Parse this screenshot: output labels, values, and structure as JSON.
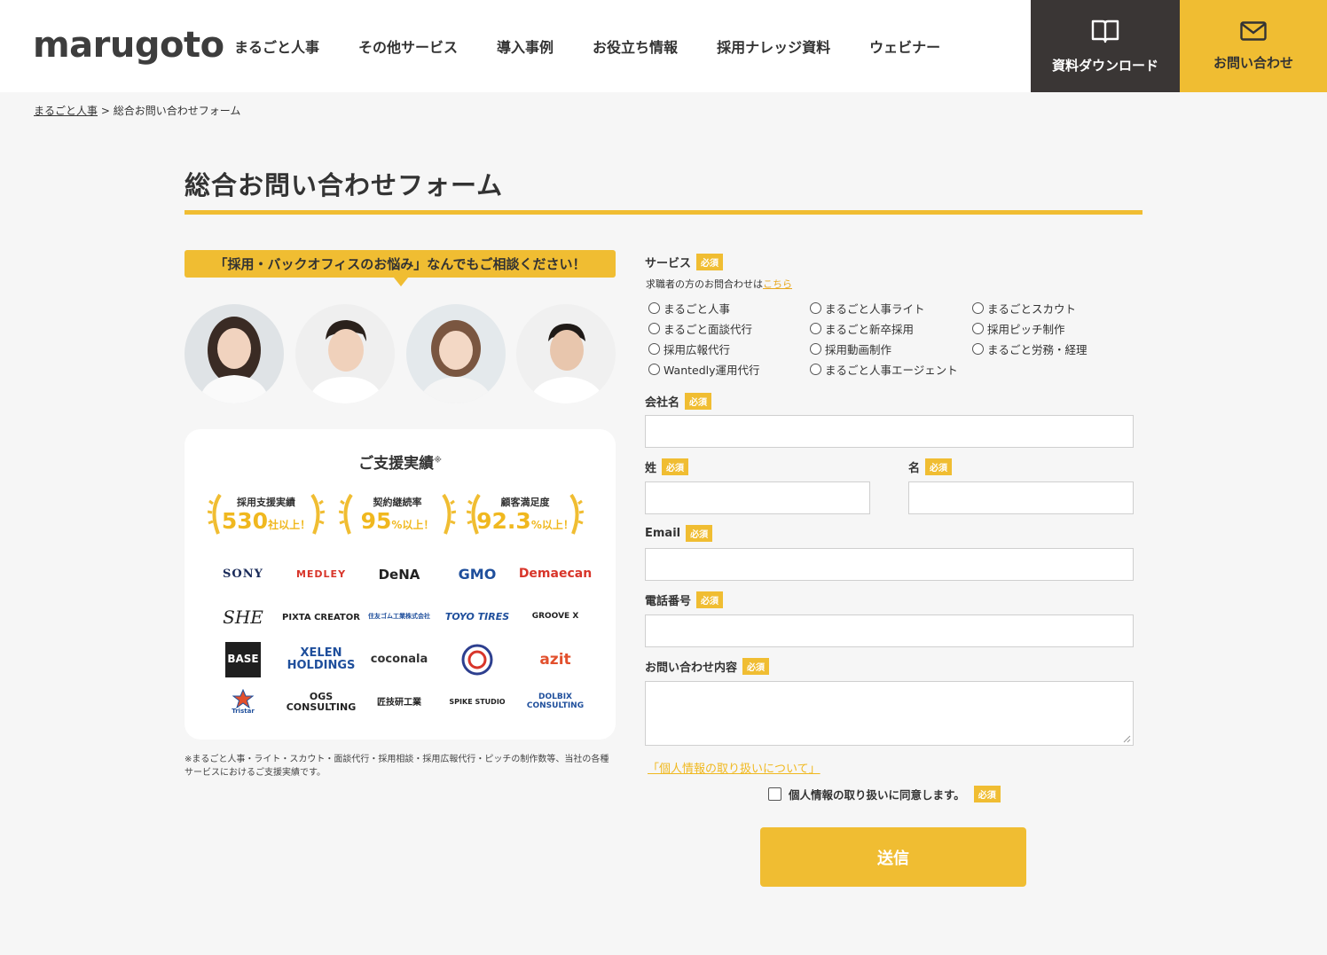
{
  "header": {
    "logo": "marugoto",
    "nav": [
      "まるごと人事",
      "その他サービス",
      "導入事例",
      "お役立ち情報",
      "採用ナレッジ資料",
      "ウェビナー"
    ],
    "download_label": "資料ダウンロード",
    "contact_label": "お問い合わせ"
  },
  "breadcrumb": {
    "home": "まるごと人事",
    "separator": ">",
    "current": "総合お問い合わせフォーム"
  },
  "page_title": "総合お問い合わせフォーム",
  "left": {
    "ribbon": "「採用・バックオフィスのお悩み」なんでもご相談ください！",
    "card_title": "ご支援実績",
    "card_title_mark": "※",
    "stats": [
      {
        "label": "採用支援実績",
        "value": "530",
        "suffix": "社以上！"
      },
      {
        "label": "契約継続率",
        "value": "95",
        "suffix": "%以上！"
      },
      {
        "label": "顧客満足度",
        "value": "92.3",
        "suffix": "%以上！"
      }
    ],
    "logos": [
      "SONY",
      "MEDLEY",
      "DeNA",
      "GMO",
      "Demaecan",
      "SHE",
      "PIXTA CREATOR",
      "住友ゴム工業株式会社",
      "TOYO TIRES",
      "GROOVE X",
      "BASE",
      "XELEN HOLDINGS",
      "coconala",
      "",
      "azit",
      "Tristar",
      "OGS CONSULTING",
      "匠技研工業",
      "SPIKE STUDIO",
      "DOLBIX CONSULTING"
    ],
    "footnote": "※まるごと人事・ライト・スカウト・面談代行・採用相談・採用広報代行・ピッチの制作数等、当社の各種サービスにおけるご支援実績です。"
  },
  "form": {
    "required": "必須",
    "service_label": "サービス",
    "note_text": "求職者の方のお問合わせは",
    "note_link": "こちら",
    "services": [
      "まるごと人事",
      "まるごと人事ライト",
      "まるごとスカウト",
      "まるごと面談代行",
      "まるごと新卒採用",
      "採用ピッチ制作",
      "採用広報代行",
      "採用動画制作",
      "まるごと労務・経理",
      "Wantedly運用代行",
      "まるごと人事エージェント"
    ],
    "company_label": "会社名",
    "last_name_label": "姓",
    "first_name_label": "名",
    "email_label": "Email",
    "phone_label": "電話番号",
    "inquiry_label": "お問い合わせ内容",
    "privacy_link": "「個人情報の取り扱いについて」",
    "agree_label": "個人情報の取り扱いに同意します。",
    "submit_label": "送信"
  },
  "colors": {
    "accent": "#f0bd32",
    "dark": "#3a3635"
  }
}
